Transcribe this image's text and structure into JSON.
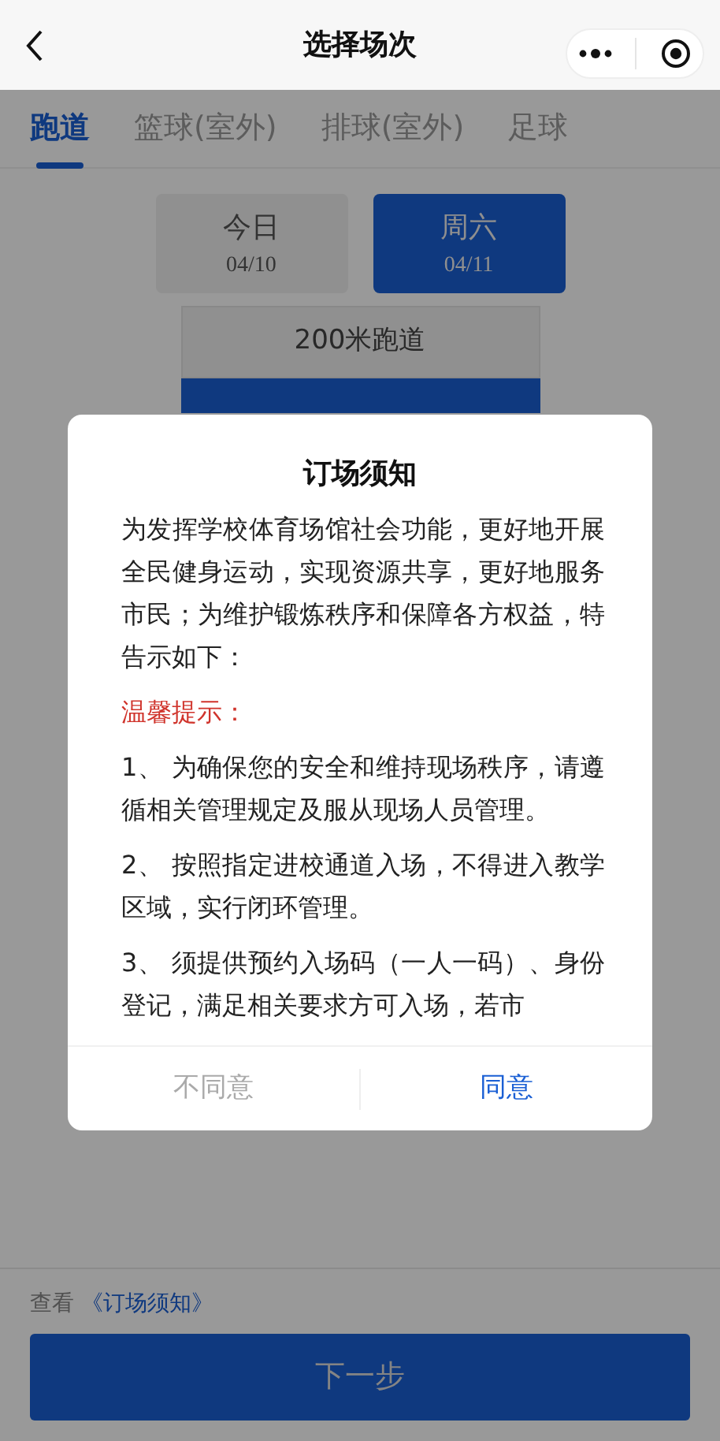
{
  "header": {
    "title": "选择场次"
  },
  "tabs": [
    {
      "label": "跑道",
      "selected": true
    },
    {
      "label": "篮球(室外)",
      "selected": false
    },
    {
      "label": "排球(室外)",
      "selected": false
    },
    {
      "label": "足球",
      "selected": false
    }
  ],
  "dates": [
    {
      "day": "今日",
      "date": "04/10",
      "selected": false
    },
    {
      "day": "周六",
      "date": "04/11",
      "selected": true
    }
  ],
  "venue": {
    "name": "200米跑道"
  },
  "dialog": {
    "title": "订场须知",
    "paragraphs": [
      {
        "kind": "plain",
        "text": "为发挥学校体育场馆社会功能，更好地开展全民健身运动，实现资源共享，更好地服务市民；为维护锻炼秩序和保障各方权益，特告示如下："
      },
      {
        "kind": "warning",
        "text": "温馨提示："
      },
      {
        "kind": "plain",
        "text": "1、 为确保您的安全和维持现场秩序，请遵循相关管理规定及服从现场人员管理。"
      },
      {
        "kind": "plain",
        "text": "2、 按照指定进校通道入场，不得进入教学区域，实行闭环管理。"
      },
      {
        "kind": "plain",
        "text": "3、 须提供预约入场码（一人一码）、身份登记，满足相关要求方可入场，若市"
      }
    ],
    "buttons": [
      {
        "label": "不同意",
        "kind": "secondary"
      },
      {
        "label": "同意",
        "kind": "primary"
      }
    ]
  },
  "footer": {
    "notice_prefix": "查看",
    "notice_link": "《订场须知》",
    "next_button": "下一步"
  }
}
